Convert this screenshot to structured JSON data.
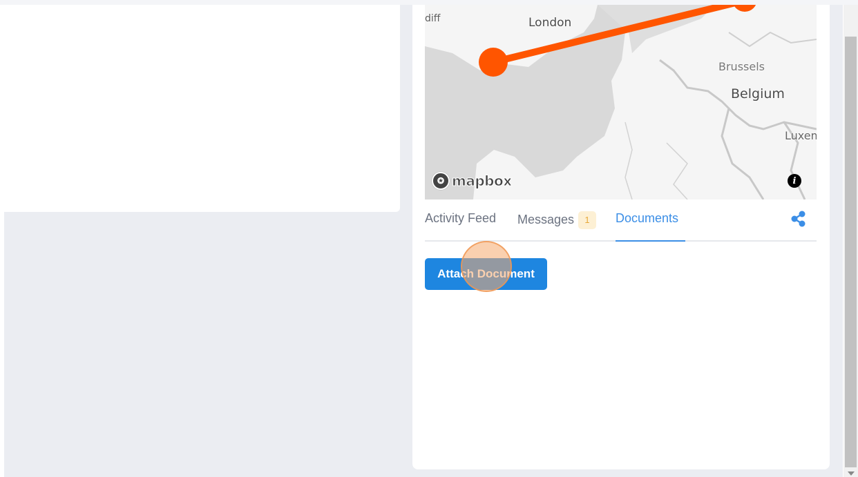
{
  "map": {
    "labels": {
      "cardiff": "diff",
      "london": "London",
      "brussels": "Brussels",
      "belgium": "Belgium",
      "luxembourg": "Luxem"
    },
    "attribution": "mapbox",
    "route_color": "#ff5500"
  },
  "tabs": [
    {
      "label": "Activity Feed"
    },
    {
      "label": "Messages",
      "badge": "1"
    },
    {
      "label": "Documents",
      "active": true
    }
  ],
  "documents": {
    "attach_label": "Attach Document"
  },
  "colors": {
    "accent": "#1e86e0",
    "tab_active": "#3b8ee6",
    "badge_bg": "#fdf0d4",
    "badge_text": "#e7a93a",
    "route": "#ff5500"
  }
}
